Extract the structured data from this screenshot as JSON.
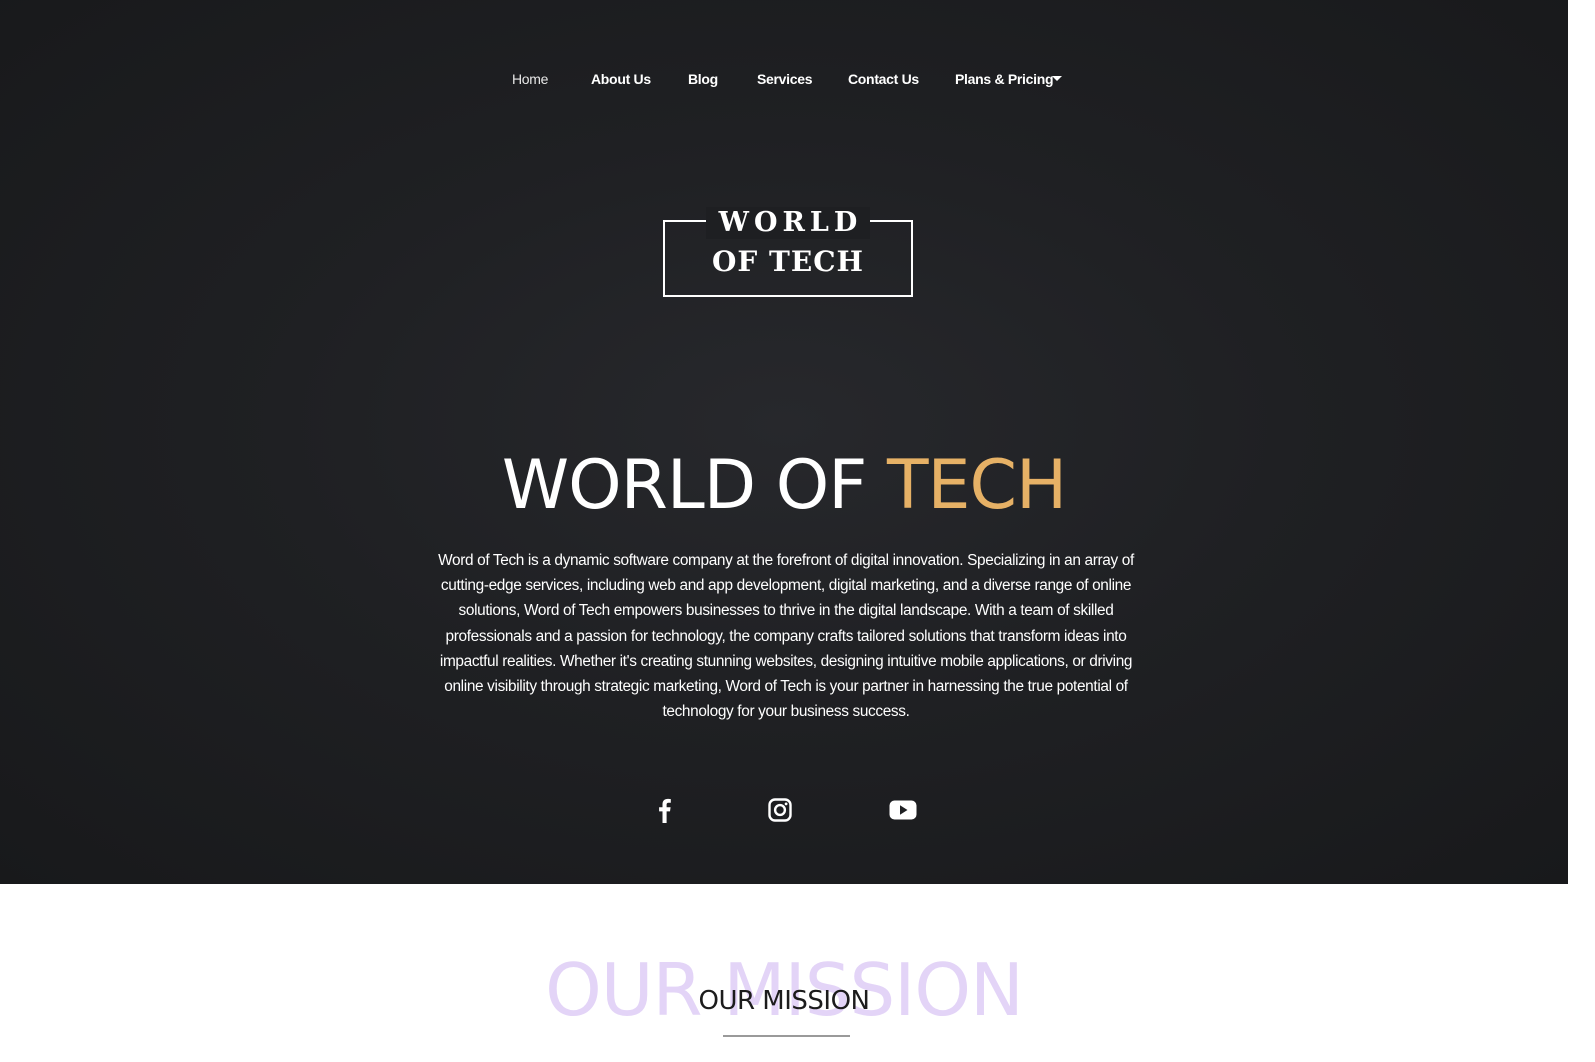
{
  "nav": {
    "items": [
      {
        "label": "Home"
      },
      {
        "label": "About Us"
      },
      {
        "label": "Blog"
      },
      {
        "label": "Services"
      },
      {
        "label": "Contact Us"
      },
      {
        "label": "Plans & Pricing"
      }
    ]
  },
  "logo": {
    "line1": "WORLD",
    "line2": "OF TECH"
  },
  "hero": {
    "title_main": "WORLD OF ",
    "title_accent": "TECH",
    "description": "Word of Tech is a dynamic software company at the forefront of digital innovation. Specializing in an array of cutting-edge services, including web and app development, digital marketing, and a diverse range of online solutions, Word of Tech empowers businesses to thrive in the digital landscape. With a team of skilled professionals and a passion for technology, the company crafts tailored solutions that transform ideas into impactful realities. Whether it's creating stunning websites, designing intuitive mobile applications, or driving online visibility through strategic marketing, Word of Tech is your partner in harnessing the true potential of technology for your business success."
  },
  "social": {
    "icons": [
      "facebook-icon",
      "instagram-icon",
      "youtube-icon"
    ]
  },
  "mission": {
    "background_text": "OUR MISSION",
    "title": "OUR MISSION"
  },
  "colors": {
    "accent": "#e6b166",
    "hero_bg": "#1f2023",
    "mission_watermark": "#e3d4f7"
  }
}
